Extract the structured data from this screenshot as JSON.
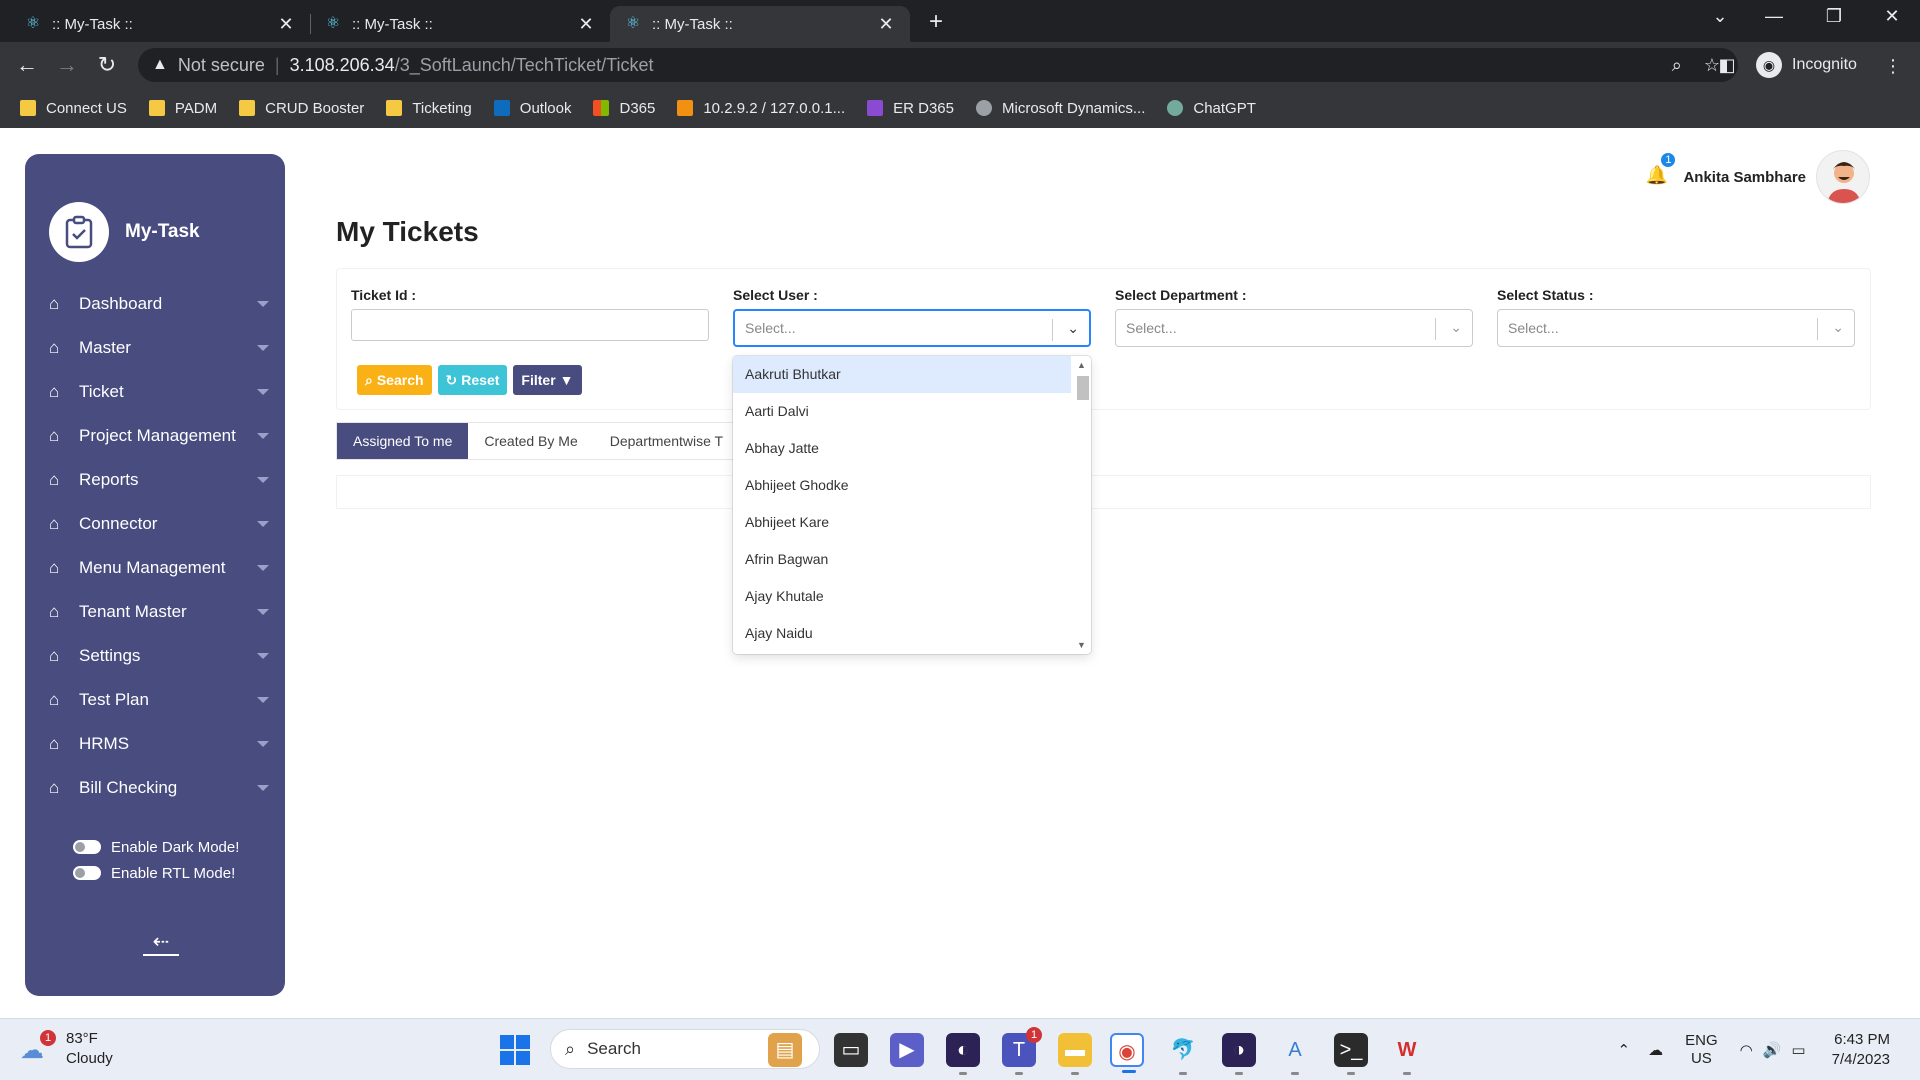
{
  "browser": {
    "tabs": [
      {
        "title": ":: My-Task ::",
        "active": false
      },
      {
        "title": ":: My-Task ::",
        "active": false
      },
      {
        "title": ":: My-Task ::",
        "active": true
      }
    ],
    "security_label": "Not secure",
    "url_host": "3.108.206.34",
    "url_path": "/3_SoftLaunch/TechTicket/Ticket",
    "profile_label": "Incognito",
    "bookmarks": [
      {
        "label": "Connect US",
        "icon": "folder-icon",
        "color": "#f6c945"
      },
      {
        "label": "PADM",
        "icon": "folder-icon",
        "color": "#f6c945"
      },
      {
        "label": "CRUD Booster",
        "icon": "folder-icon",
        "color": "#f6c945"
      },
      {
        "label": "Ticketing",
        "icon": "folder-icon",
        "color": "#f6c945"
      },
      {
        "label": "Outlook",
        "icon": "outlook-icon",
        "color": "#0f6cbd"
      },
      {
        "label": "D365",
        "icon": "microsoft-icon",
        "color": "#f25022"
      },
      {
        "label": "10.2.9.2 / 127.0.0.1...",
        "icon": "phpmyadmin-icon",
        "color": "#f29111"
      },
      {
        "label": "ER D365",
        "icon": "power-apps-icon",
        "color": "#8a4ad1"
      },
      {
        "label": "Microsoft Dynamics...",
        "icon": "globe-icon",
        "color": "#9aa0a6"
      },
      {
        "label": "ChatGPT",
        "icon": "chatgpt-icon",
        "color": "#74aa9c"
      }
    ]
  },
  "app": {
    "brand": "My-Task",
    "menu": [
      {
        "label": "Dashboard"
      },
      {
        "label": "Master"
      },
      {
        "label": "Ticket"
      },
      {
        "label": "Project Management"
      },
      {
        "label": "Reports"
      },
      {
        "label": "Connector"
      },
      {
        "label": "Menu Management"
      },
      {
        "label": "Tenant Master"
      },
      {
        "label": "Settings"
      },
      {
        "label": "Test Plan"
      },
      {
        "label": "HRMS"
      },
      {
        "label": "Bill Checking"
      }
    ],
    "toggles": {
      "dark_mode": "Enable Dark Mode!",
      "rtl_mode": "Enable RTL Mode!"
    },
    "user": {
      "name": "Ankita Sambhare",
      "notification_count": "1"
    },
    "page_title": "My Tickets",
    "filters": {
      "ticket_id_label": "Ticket Id :",
      "user_label": "Select User :",
      "department_label": "Select Department :",
      "status_label": "Select Status :",
      "placeholder": "Select..."
    },
    "buttons": {
      "search": "Search",
      "reset": "Reset",
      "filter": "Filter"
    },
    "tabs": [
      {
        "label": "Assigned To me",
        "active": true
      },
      {
        "label": "Created By Me",
        "active": false
      },
      {
        "label": "Departmentwise T",
        "active": false
      }
    ],
    "user_options": [
      "Aakruti Bhutkar",
      "Aarti Dalvi",
      "Abhay Jatte",
      "Abhijeet Ghodke",
      "Abhijeet Kare",
      "Afrin Bagwan",
      "Ajay Khutale",
      "Ajay Naidu"
    ],
    "accent_color": "#484c7f"
  },
  "taskbar": {
    "weather_temp": "83°F",
    "weather_desc": "Cloudy",
    "weather_badge": "1",
    "search_label": "Search",
    "teams_badge": "1",
    "lang_line1": "ENG",
    "lang_line2": "US",
    "time": "6:43 PM",
    "date": "7/4/2023"
  }
}
